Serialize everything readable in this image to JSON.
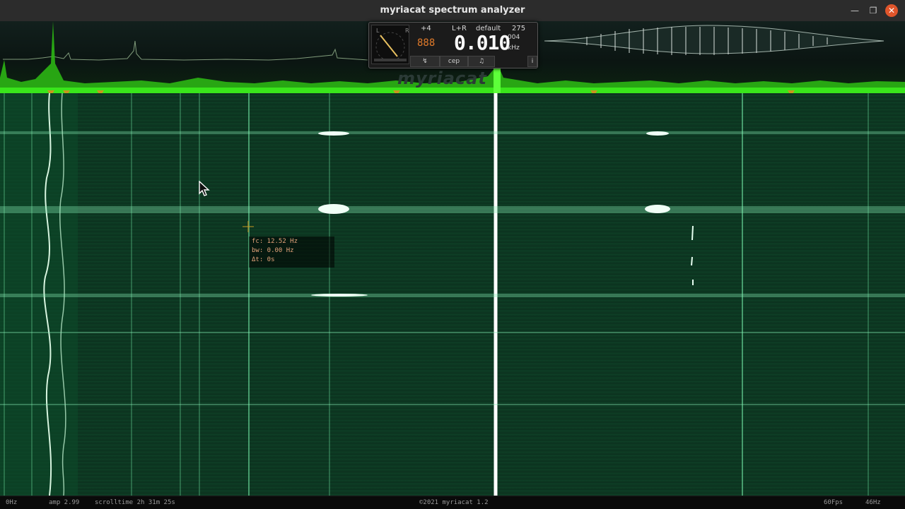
{
  "window": {
    "title": "myriacat spectrum analyzer",
    "controls": {
      "minimize": "—",
      "maximize": "❐",
      "close": "✕"
    }
  },
  "panel": {
    "meter_left_label": "L",
    "meter_right_label": "R",
    "gain": "+4",
    "led_digits": "888",
    "channel": "L+R",
    "preset": "default",
    "preset_number": "275",
    "frequency": "0.010",
    "frequency_fine": "004",
    "frequency_unit": "kHz",
    "buttons": [
      {
        "label": "↯",
        "icon": "tuning-fork-icon"
      },
      {
        "label": "cep"
      },
      {
        "label": "♫",
        "icon": "music-note-icon"
      },
      {
        "label": "i",
        "icon": "info-icon"
      }
    ]
  },
  "watermark": "myriacat",
  "tooltip": {
    "fc": "fc: 12.52 Hz",
    "bw": "bw: 0.00 Hz",
    "dt": "Δt: 0s"
  },
  "status": {
    "freq_low": "0Hz",
    "amp": "amp 2.99",
    "scrolltime": "scrolltime 2h 31m 25s",
    "copyright": "©2021 myriacat 1.2",
    "fps": "60Fps",
    "freq_high": "46Hz"
  },
  "colors": {
    "spectrum_green": "#39e61b",
    "spectrogram_bg": "#0e3a24",
    "marker_orange": "#c8961e",
    "close_button": "#e0552b"
  }
}
